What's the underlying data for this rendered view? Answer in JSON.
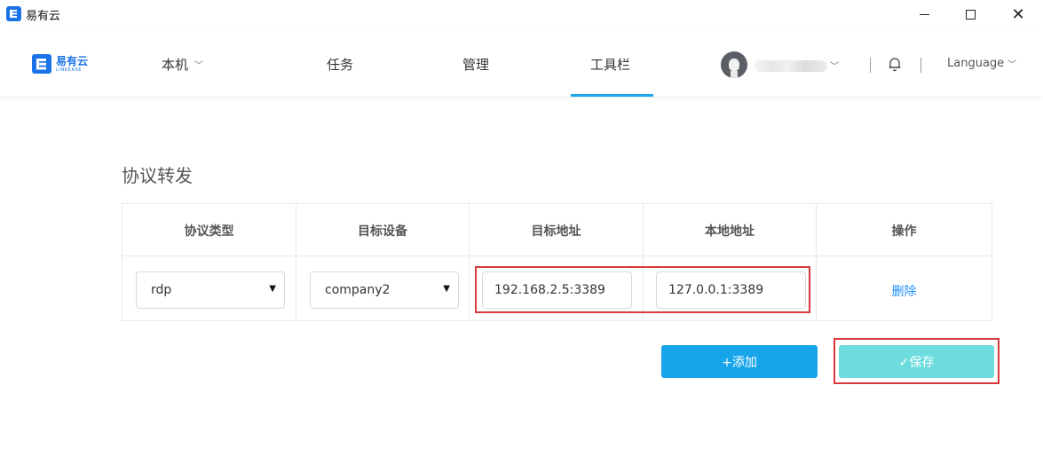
{
  "window": {
    "title": "易有云",
    "app_icon": "app-logo-icon",
    "min_icon": "minimize-icon",
    "max_icon": "maximize-icon",
    "close_symbol": "✕"
  },
  "nav": {
    "logo": {
      "cn": "易有云",
      "en": "LINKEASE",
      "icon": "linkease-logo-icon"
    },
    "items": [
      {
        "label": "本机",
        "has_dropdown": true
      },
      {
        "label": "任务"
      },
      {
        "label": "管理"
      },
      {
        "label": "工具栏",
        "active": true
      }
    ],
    "dropdown_glyph": "﹀",
    "user": {
      "avatar": "avatar-icon",
      "name_hidden": true
    },
    "bell_icon": "bell-icon",
    "language_label": "Language",
    "accent_color": "#1ea7e8"
  },
  "page": {
    "section_title": "协议转发",
    "table": {
      "headers": [
        "协议类型",
        "目标设备",
        "目标地址",
        "本地地址",
        "操作"
      ],
      "rows": [
        {
          "protocol": "rdp",
          "device": "company2",
          "target_address": "192.168.2.5:3389",
          "local_address": "127.0.0.1:3389",
          "action": "删除"
        }
      ]
    },
    "select_arrow": "▼",
    "add_button": "+添加",
    "save_button": "✓保存",
    "add_color": "#17a5ea",
    "save_color": "#6cdcde",
    "highlight_color": "#d9393a"
  }
}
